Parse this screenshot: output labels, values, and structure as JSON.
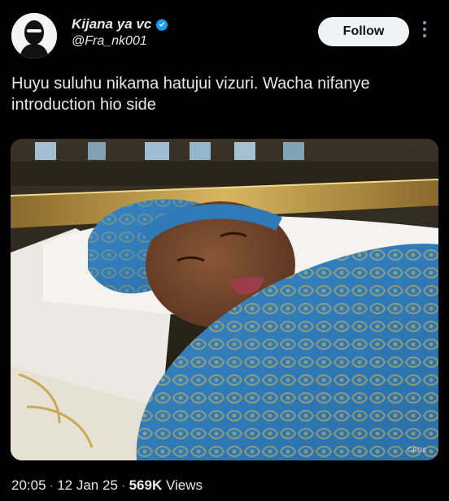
{
  "author": {
    "display_name": "Kijana ya vc",
    "handle": "@Fra_nk001",
    "avatar_icon": "masked-figure-avatar",
    "verified_icon": "verified-badge-icon",
    "verified_color": "#1d9bf0"
  },
  "actions": {
    "follow_label": "Follow",
    "more_icon": "more-vertical-icon"
  },
  "tweet": {
    "text": "Huyu suluhu nikama hatujui vizuri. Wacha nifanye introduction hio side"
  },
  "media": {
    "watermark": "GROK"
  },
  "meta": {
    "time": "20:05",
    "date": "12 Jan 25",
    "views_count": "569K",
    "views_label": "Views"
  },
  "colors": {
    "background": "#000000",
    "text": "#e7e9ea",
    "button_bg": "#eff3f4"
  }
}
